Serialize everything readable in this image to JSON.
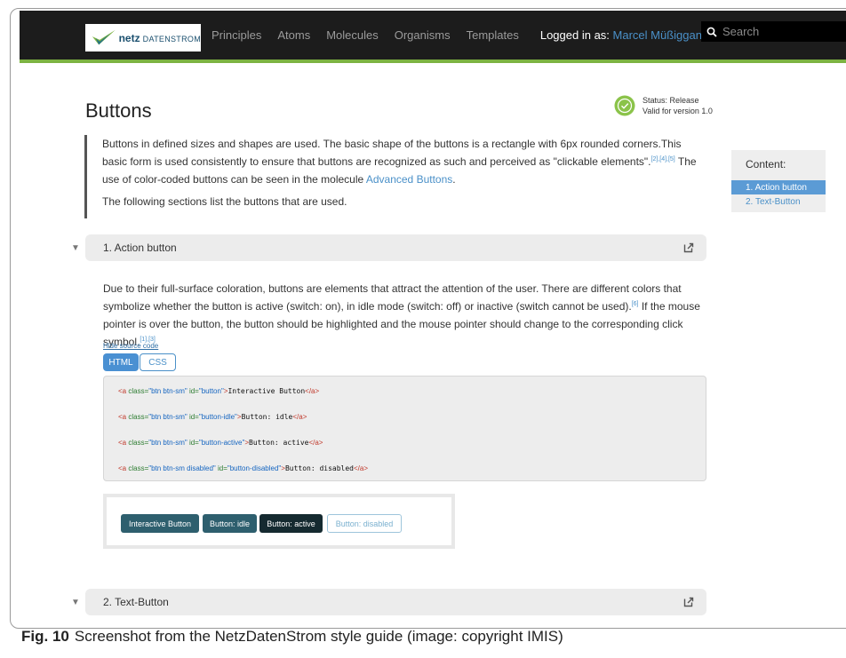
{
  "navbar": {
    "logo_bold": "netz",
    "logo_rest": "DATENSTROM",
    "items": [
      "Principles",
      "Atoms",
      "Molecules",
      "Organisms",
      "Templates"
    ],
    "login_label": "Logged in as:",
    "login_user": "Marcel Müßiggang",
    "search_placeholder": "Search"
  },
  "page": {
    "title": "Buttons",
    "status_line1": "Status: Release",
    "status_line2": "Valid for version 1.0"
  },
  "intro": {
    "p1_a": "Buttons in defined sizes and shapes are used. The basic shape of the buttons is a rectangle with 6px rounded corners.This basic form is used consistently to ensure that buttons are recognized as such and perceived as \"clickable elements\".",
    "p1_ref": "[2],[4],[5]",
    "p1_b": " The use of color-coded buttons can be seen in the molecule ",
    "p1_link": "Advanced Buttons",
    "p1_c": ".",
    "p2": "The following sections list the buttons that are used."
  },
  "toc": {
    "heading": "Content:",
    "items": [
      "1. Action button",
      "2. Text-Button"
    ]
  },
  "section1": {
    "title": "1. Action button",
    "text_a": "Due to their full-surface coloration, buttons are elements that attract the attention of the user. There are different colors that symbolize whether the button is active (switch: on), in idle mode (switch: off) or inactive (switch cannot be used).",
    "ref_a": "[6]",
    "text_b": " If the mouse pointer is over the button, the button should be highlighted and the mouse pointer should change to the corresponding click symbol.",
    "ref_b": "[1],[3]",
    "hide_source": "Hide source code",
    "tab_html": "HTML",
    "tab_css": "CSS"
  },
  "code_lines": [
    {
      "open": "<a ",
      "attr1": "class=",
      "val1": "\"btn btn-sm\"",
      "attr2": " id=",
      "val2": "\"button\"",
      "close": ">",
      "text": "Interactive Button",
      "end": "</a>"
    },
    {
      "open": "<a ",
      "attr1": "class=",
      "val1": "\"btn btn-sm\"",
      "attr2": " id=",
      "val2": "\"button-idle\"",
      "close": ">",
      "text": "Button: idle",
      "end": "</a>"
    },
    {
      "open": "<a ",
      "attr1": "class=",
      "val1": "\"btn btn-sm\"",
      "attr2": " id=",
      "val2": "\"button-active\"",
      "close": ">",
      "text": "Button: active",
      "end": "</a>"
    },
    {
      "open": "<a ",
      "attr1": "class=",
      "val1": "\"btn btn-sm disabled\"",
      "attr2": " id=",
      "val2": "\"button-disabled\"",
      "close": ">",
      "text": "Button: disabled",
      "end": "</a>"
    }
  ],
  "preview": {
    "interactive": "Interactive Button",
    "idle": "Button: idle",
    "active": "Button: active",
    "disabled": "Button: disabled"
  },
  "section2": {
    "title": "2. Text-Button"
  },
  "caption": {
    "label": "Fig. 10",
    "text": "Screenshot from the NetzDatenStrom style guide (image: copyright IMIS)"
  },
  "colors": {
    "navbar_bg": "#1c1c1c",
    "navbar_accent": "#7cb342",
    "link": "#4a90c8",
    "button_primary": "#2e5f6e",
    "button_active": "#152a30"
  }
}
